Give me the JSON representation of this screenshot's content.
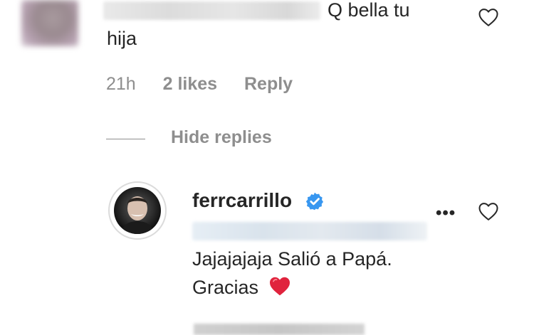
{
  "comment": {
    "text_line1": "Q bella tu",
    "text_line2": "hija",
    "time": "21h",
    "likes": "2 likes",
    "reply_label": "Reply",
    "hide_replies": "Hide replies"
  },
  "reply": {
    "username": "ferrcarrillo",
    "text_line1": "Jajajajaja Salió a Papá.",
    "text_line2": "Gracias",
    "more": "•••",
    "heart_emoji": "❤️"
  },
  "icons": {
    "like": "heart-outline-icon",
    "verified": "verified-badge-icon",
    "more": "more-options-icon"
  },
  "colors": {
    "text": "#262626",
    "muted": "#8e8e8e",
    "verified": "#3897f0",
    "emoji_heart": "#e0233d"
  }
}
